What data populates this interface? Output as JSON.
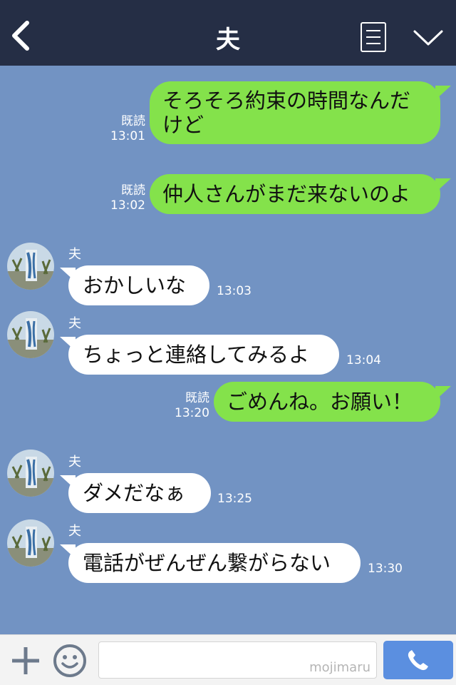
{
  "header": {
    "title": "夫"
  },
  "messages": [
    {
      "side": "out",
      "text_lines": [
        "そろそろ約束の時間なんだ",
        "けど"
      ],
      "read": "既読",
      "time": "13:01"
    },
    {
      "side": "out",
      "text_lines": [
        "仲人さんがまだ来ないのよ"
      ],
      "read": "既読",
      "time": "13:02"
    },
    {
      "side": "in",
      "sender": "夫",
      "text": "おかしいな",
      "time": "13:03"
    },
    {
      "side": "in",
      "sender": "夫",
      "text": "ちょっと連絡してみるよ",
      "time": "13:04"
    },
    {
      "side": "out",
      "text_lines": [
        "ごめんね。お願い！"
      ],
      "read": "既読",
      "time": "13:20"
    },
    {
      "side": "in",
      "sender": "夫",
      "text": "ダメだなぁ",
      "time": "13:25"
    },
    {
      "side": "in",
      "sender": "夫",
      "text": "電話がぜんぜん繋がらない",
      "time": "13:30"
    }
  ],
  "footer": {
    "input_value": "",
    "watermark": "mojimaru"
  },
  "colors": {
    "header_bg": "#252e45",
    "chat_bg": "#7293c3",
    "outgoing_bubble": "#84e24b",
    "incoming_bubble": "#ffffff",
    "call_button": "#5b8fe0"
  },
  "icons": [
    "back-arrow-icon",
    "menu-list-icon",
    "chevron-down-icon",
    "plus-icon",
    "emoji-icon",
    "phone-icon"
  ]
}
